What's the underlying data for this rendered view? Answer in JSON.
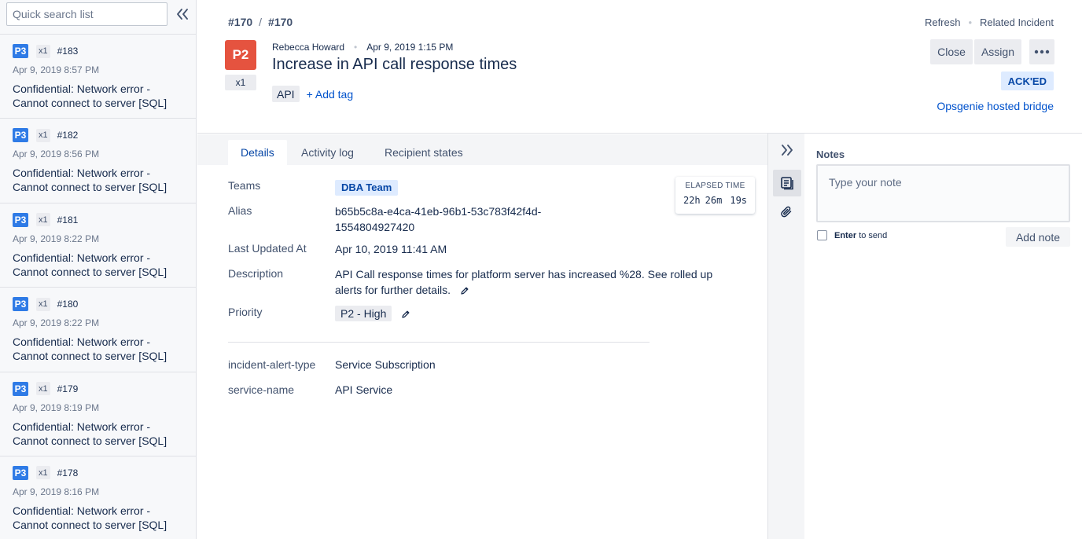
{
  "sidebar": {
    "search_placeholder": "Quick search list",
    "items": [
      {
        "priority": "P3",
        "count": "x1",
        "number": "#183",
        "date": "Apr 9, 2019 8:57 PM",
        "message": "Confidential: Network error - Cannot connect to server [SQL]"
      },
      {
        "priority": "P3",
        "count": "x1",
        "number": "#182",
        "date": "Apr 9, 2019 8:56 PM",
        "message": "Confidential: Network error - Cannot connect to server [SQL]"
      },
      {
        "priority": "P3",
        "count": "x1",
        "number": "#181",
        "date": "Apr 9, 2019 8:22 PM",
        "message": "Confidential: Network error - Cannot connect to server [SQL]"
      },
      {
        "priority": "P3",
        "count": "x1",
        "number": "#180",
        "date": "Apr 9, 2019 8:22 PM",
        "message": "Confidential: Network error - Cannot connect to server [SQL]"
      },
      {
        "priority": "P3",
        "count": "x1",
        "number": "#179",
        "date": "Apr 9, 2019 8:19 PM",
        "message": "Confidential: Network error - Cannot connect to server [SQL]"
      },
      {
        "priority": "P3",
        "count": "x1",
        "number": "#178",
        "date": "Apr 9, 2019 8:16 PM",
        "message": "Confidential: Network error - Cannot connect to server [SQL]"
      }
    ]
  },
  "header": {
    "breadcrumb": [
      "#170",
      "#170"
    ],
    "breadcrumb_separator": "/",
    "priority": "P2",
    "count": "x1",
    "author": "Rebecca Howard",
    "created": "Apr 9, 2019 1:15 PM",
    "title": "Increase in API call response times",
    "tags": [
      "API"
    ],
    "add_tag_label": "+ Add tag",
    "links": {
      "refresh": "Refresh",
      "related": "Related Incident"
    },
    "buttons": {
      "close": "Close",
      "assign": "Assign",
      "more": "•••"
    },
    "status": "ACK'ED",
    "bridge_link": "Opsgenie hosted bridge"
  },
  "tabs": [
    {
      "label": "Details",
      "active": true
    },
    {
      "label": "Activity log",
      "active": false
    },
    {
      "label": "Recipient states",
      "active": false
    }
  ],
  "details": {
    "teams_label": "Teams",
    "team": "DBA Team",
    "alias_label": "Alias",
    "alias_line1": "b65b5c8a-e4ca-41eb-96b1-53c783f42f4d-",
    "alias_line2": "1554804927420",
    "last_updated_label": "Last Updated At",
    "last_updated": "Apr 10, 2019 11:41 AM",
    "description_label": "Description",
    "description_line1": "API Call response times for platform server has increased %28. See rolled up",
    "description_line2": "alerts for further details.",
    "priority_label": "Priority",
    "priority": "P2 - High",
    "extra": [
      {
        "key": "incident-alert-type",
        "value": "Service Subscription"
      },
      {
        "key": "service-name",
        "value": "API Service"
      }
    ]
  },
  "elapsed": {
    "label": "ELAPSED TIME",
    "hours": "22h",
    "minutes": "26m",
    "seconds": "19s"
  },
  "notes": {
    "title": "Notes",
    "placeholder": "Type your note",
    "enter_key": "Enter",
    "enter_suffix": "to send",
    "add_button": "Add note"
  },
  "colors": {
    "p3": "#2f7be6",
    "p2": "#e5533f",
    "link": "#0052cc",
    "acked_bg": "#deebff"
  },
  "icons": {
    "collapse_list": "double-chevron-left-icon",
    "collapse_panel": "double-chevron-right-icon",
    "notes": "notes-icon",
    "attachment": "paperclip-icon",
    "edit": "pencil-icon"
  }
}
